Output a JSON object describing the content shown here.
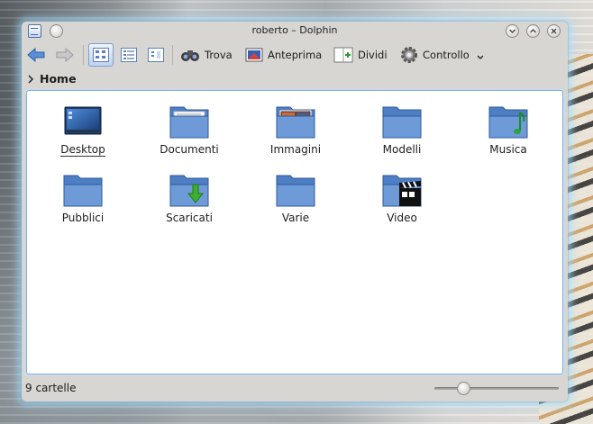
{
  "window": {
    "title": "roberto – Dolphin"
  },
  "titlebar_buttons": [
    "minimize",
    "maximize",
    "close"
  ],
  "toolbar": {
    "trova": "Trova",
    "anteprima": "Anteprima",
    "dividi": "Dividi",
    "controllo": "Controllo"
  },
  "breadcrumb": {
    "current": "Home"
  },
  "items": [
    {
      "label": "Desktop",
      "icon": "desktop-icon",
      "current": true
    },
    {
      "label": "Documenti",
      "icon": "folder-documents-icon"
    },
    {
      "label": "Immagini",
      "icon": "folder-images-icon"
    },
    {
      "label": "Modelli",
      "icon": "folder-templates-icon"
    },
    {
      "label": "Musica",
      "icon": "folder-music-icon"
    },
    {
      "label": "Pubblici",
      "icon": "folder-public-icon"
    },
    {
      "label": "Scaricati",
      "icon": "folder-downloads-icon"
    },
    {
      "label": "Varie",
      "icon": "folder-icon"
    },
    {
      "label": "Video",
      "icon": "folder-video-icon"
    }
  ],
  "status": {
    "text": "9 cartelle",
    "zoom_fraction": 0.2
  },
  "colors": {
    "folder": "#5f8fd0",
    "selection": "#7faee0",
    "accent": "#3b6fc4"
  }
}
